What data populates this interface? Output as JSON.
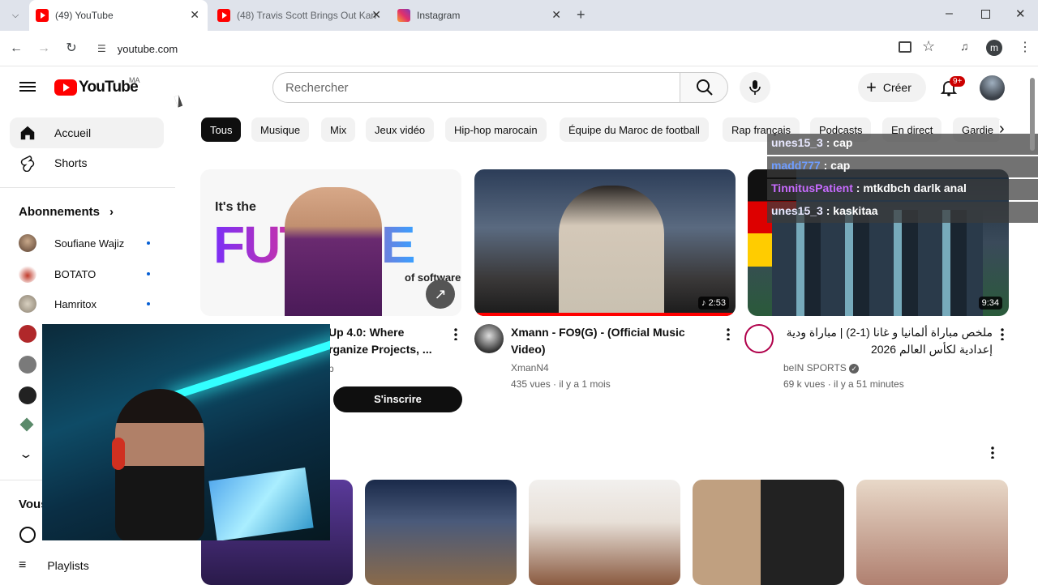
{
  "browser": {
    "tabs": [
      {
        "label": "(49) YouTube",
        "favicon": "youtube-icon",
        "active": true
      },
      {
        "label": "(48) Travis Scott Brings Out Kan",
        "favicon": "youtube-icon",
        "active": false
      },
      {
        "label": "Instagram",
        "favicon": "instagram-icon",
        "active": false
      }
    ],
    "url": "youtube.com",
    "profile_initial": "m"
  },
  "youtube": {
    "logo_text": "YouTube",
    "country_code": "MA",
    "search_placeholder": "Rechercher",
    "create_label": "Créer",
    "notifications": "9+",
    "sidebar": {
      "home": "Accueil",
      "shorts": "Shorts",
      "subscriptions_title": "Abonnements",
      "subscriptions": [
        "Soufiane Wajiz",
        "BOTATO",
        "Hamritox"
      ],
      "you_title": "Vous",
      "playlists": "Playlists"
    },
    "chips": [
      "Tous",
      "Musique",
      "Mix",
      "Jeux vidéo",
      "Hip-hop marocain",
      "Équipe du Maroc de football",
      "Rap français",
      "Podcasts",
      "En direct",
      "Gardie"
    ],
    "videos": [
      {
        "title_line1": "Up 4.0: Where",
        "title_line2": "rganize Projects, ...",
        "channel": "p",
        "cta": "S'inscrire",
        "thumb_headline": "It's the",
        "thumb_big": "FUTURE",
        "thumb_sub": "of software"
      },
      {
        "title_line1": "Xmann - FO9(G) - (Official Music",
        "title_line2": "Video)",
        "channel": "XmanN4",
        "meta": "435 vues · il y a 1 mois",
        "duration": "2:53"
      },
      {
        "title_line1": "ملخص مباراة ألمانيا و غانا (1-2) | مباراة ودية",
        "title_line2": "إعدادية لكأس العالم 2026",
        "channel": "beIN SPORTS",
        "meta": "69 k vues · il y a 51 minutes",
        "duration": "9:34"
      }
    ]
  },
  "chat": [
    {
      "user": "unes15_3",
      "msg": "cap",
      "color": "#e8e8ff"
    },
    {
      "user": "madd777",
      "msg": "cap",
      "color": "#6f9dff"
    },
    {
      "user": "TinnitusPatient",
      "msg": "mtkdbch darlk anal",
      "color": "#c86bff"
    },
    {
      "user": "unes15_3",
      "msg": "kaskitaa",
      "color": "#e8e8ff"
    }
  ]
}
